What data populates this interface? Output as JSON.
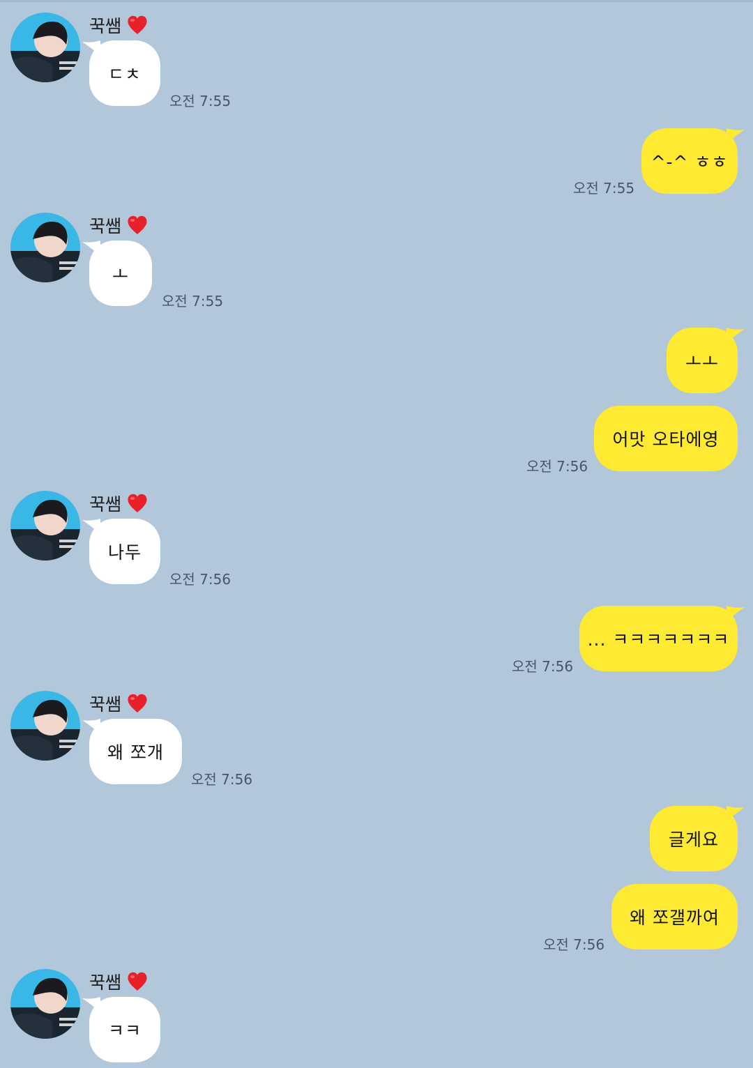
{
  "chat": {
    "contact_name": "꾹쌤",
    "messages": [
      {
        "from": "them",
        "text": "ㄷㅊ",
        "time": "오전 7:55"
      },
      {
        "from": "me",
        "text": "^-^ ㅎㅎ",
        "time": "오전 7:55"
      },
      {
        "from": "them",
        "text": "ㅗ",
        "time": "오전 7:55"
      },
      {
        "from": "me",
        "text": "ㅗㅗ",
        "time": ""
      },
      {
        "from": "me",
        "text": "어맛 오타에영",
        "time": "오전 7:56"
      },
      {
        "from": "them",
        "text": "나두",
        "time": "오전 7:56"
      },
      {
        "from": "me",
        "text": "... ㅋㅋㅋㅋㅋㅋㅋ",
        "time": "오전 7:56"
      },
      {
        "from": "them",
        "text": "왜 쪼개",
        "time": "오전 7:56"
      },
      {
        "from": "me",
        "text": "글게요",
        "time": ""
      },
      {
        "from": "me",
        "text": "왜 쪼갤까여",
        "time": "오전 7:56"
      },
      {
        "from": "them",
        "text": "ㅋㅋ",
        "time": ""
      }
    ]
  },
  "colors": {
    "background": "#b2c7da",
    "incoming_bubble": "#ffffff",
    "outgoing_bubble": "#fee933",
    "heart": "#e8202a"
  },
  "icons": {
    "contact_badge": "red-heart-emoji",
    "avatar": "profile-photo"
  }
}
